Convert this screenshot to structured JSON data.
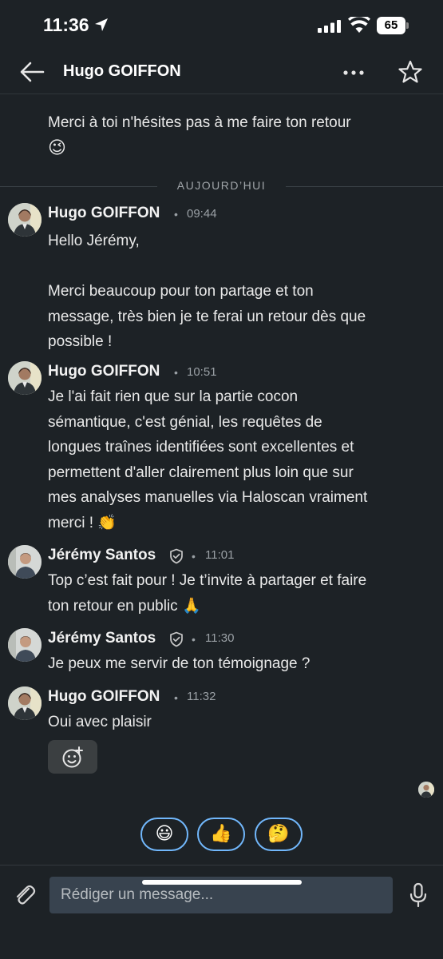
{
  "status_bar": {
    "time": "11:36",
    "battery": "65"
  },
  "header": {
    "title": "Hugo GOIFFON"
  },
  "first_message": {
    "text": "Merci à toi n'hésites pas à me faire ton retour",
    "emoji": "😉"
  },
  "day_divider": "AUJOURD’HUI",
  "messages": [
    {
      "sender": "Hugo GOIFFON",
      "time": "09:44",
      "lines": [
        "Hello Jérémy,",
        "",
        "Merci beaucoup pour ton partage et ton",
        "message, très bien je te ferai un retour dès que",
        "possible !"
      ]
    },
    {
      "sender": "Hugo GOIFFON",
      "time": "10:51",
      "lines": [
        "Je l'ai fait rien que sur la partie cocon",
        "sémantique, c'est génial, les requêtes de",
        "longues traînes identifiées sont excellentes et",
        "permettent d'aller clairement plus loin que sur",
        "mes analyses manuelles via Haloscan vraiment",
        "merci ! 👏"
      ]
    },
    {
      "sender": "Jérémy Santos",
      "time": "11:01",
      "lines": [
        "Top c’est fait pour ! Je t’invite à partager et faire",
        "ton retour en public 🙏"
      ]
    },
    {
      "sender": "Jérémy Santos",
      "time": "11:30",
      "lines": [
        "Je peux me servir de ton témoignage ?"
      ]
    },
    {
      "sender": "Hugo GOIFFON",
      "time": "11:32",
      "lines": [
        "Oui avec plaisir"
      ]
    }
  ],
  "meta_separator": "•",
  "quick_replies": [
    "😃",
    "👍",
    "🤔"
  ],
  "composer": {
    "placeholder": "Rédiger un message..."
  },
  "colors": {
    "background": "#1d2226",
    "accent": "#71b7fb",
    "input_bg": "#38434f"
  }
}
